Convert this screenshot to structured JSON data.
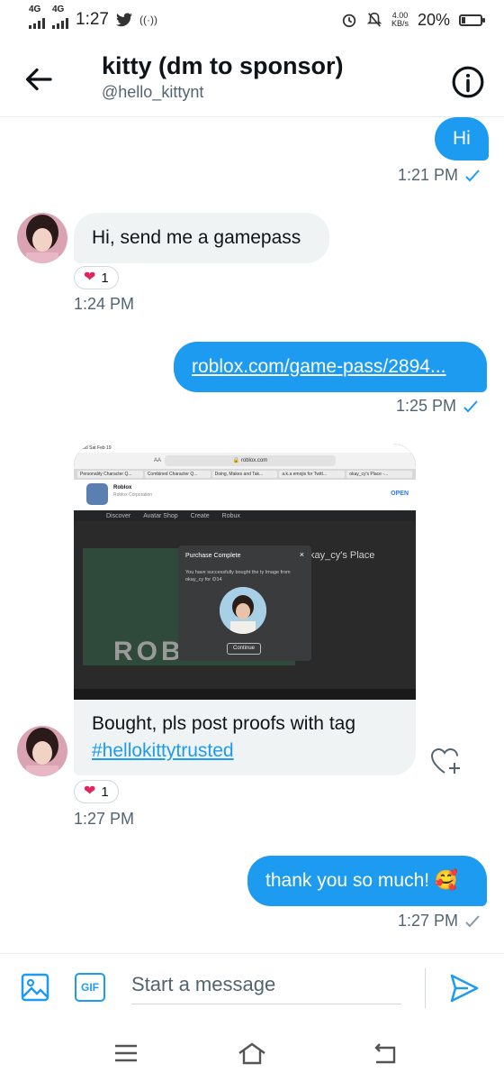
{
  "status_bar": {
    "network_1": "4G",
    "network_2": "4G",
    "time": "1:27",
    "speed_value": "4.00",
    "speed_unit": "KB/s",
    "battery_percent": "20%",
    "battery_level": 0.2
  },
  "header": {
    "title": "kitty (dm to sponsor)",
    "handle": "@hello_kittynt"
  },
  "messages": [
    {
      "type": "sent",
      "text": "Hi",
      "time": "1:21 PM"
    },
    {
      "type": "received",
      "text": "Hi, send me a gamepass",
      "reaction_count": "1",
      "time": "1:24 PM"
    },
    {
      "type": "sent",
      "text": "roblox.com/game-pass/2894...",
      "time": "1:25 PM"
    },
    {
      "type": "received",
      "text_line1": "Bought, pls post proofs with tag",
      "hashtag": "#hellokittytrusted",
      "reaction_count": "1",
      "time": "1:27 PM"
    },
    {
      "type": "sent",
      "text": "thank you so much! 🥰",
      "time": "1:27 PM"
    }
  ],
  "screenshot": {
    "status": "8:58   Sat Feb 19",
    "url": "🔒 roblox.com",
    "url_left": "AA",
    "tabs": [
      "Personality Character Q...",
      "Combined Character Q...",
      "Doing, Makes and Tak...",
      "a.k.a emojis for Twitt...",
      "okay_cy's Place -..."
    ],
    "app_name": "Roblox",
    "app_publisher": "Roblox Corporation",
    "app_open": "OPEN",
    "nav": [
      "Discover",
      "Avatar Shop",
      "Create",
      "Robux"
    ],
    "place_title": "kay_cy's Place",
    "modal_title": "Purchase Complete",
    "modal_close": "×",
    "modal_text": "You have successfully bought the ty Image from okay_cy for ⏣14",
    "modal_button": "Continue",
    "roblox_word": "ROBLOX"
  },
  "composer": {
    "gif_label": "GIF",
    "placeholder": "Start a message"
  },
  "colors": {
    "accent": "#1d9bf0",
    "bubble_received": "#eff3f4",
    "heart": "#e0245e"
  },
  "icons": [
    "back-arrow-icon",
    "info-icon",
    "heart-icon",
    "read-check-icon",
    "sent-check-icon",
    "add-reaction-icon",
    "image-icon",
    "gif-icon",
    "send-icon",
    "menu-icon",
    "home-icon",
    "back-nav-icon"
  ]
}
